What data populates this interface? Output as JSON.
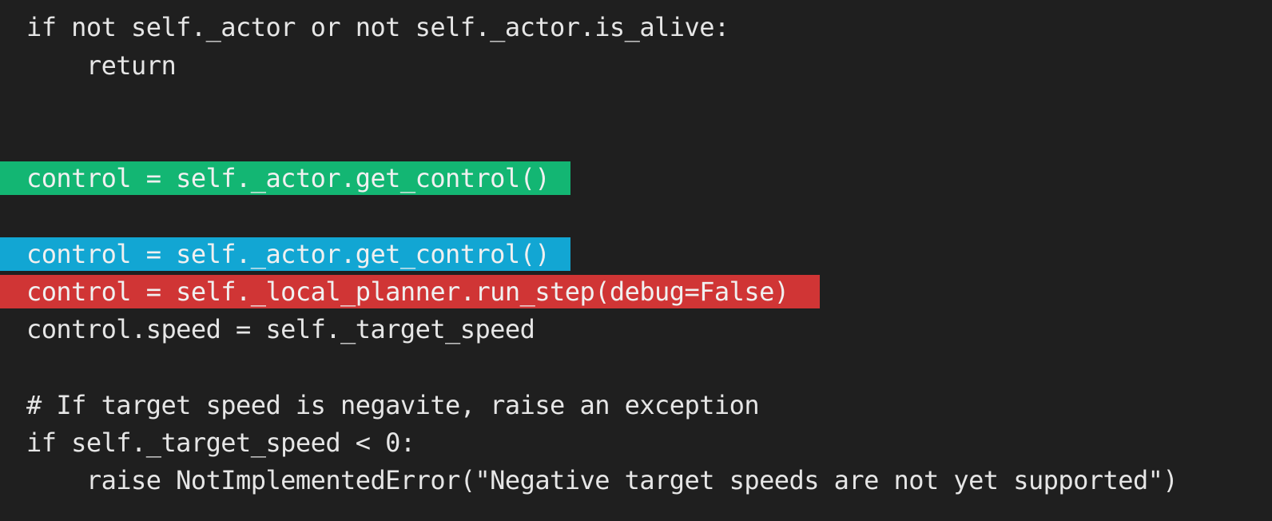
{
  "code_lines": [
    {
      "text": "if not self._actor or not self._actor.is_alive:",
      "highlight": ""
    },
    {
      "text": "    return",
      "highlight": ""
    },
    {
      "text": "",
      "highlight": ""
    },
    {
      "text": "",
      "highlight": ""
    },
    {
      "text": "control = self._actor.get_control()",
      "highlight": "#13b673"
    },
    {
      "text": "",
      "highlight": ""
    },
    {
      "text": "control = self._actor.get_control()",
      "highlight": "#12a6d3"
    },
    {
      "text": "control = self._local_planner.run_step(debug=False)",
      "highlight": "#d03535"
    },
    {
      "text": "control.speed = self._target_speed",
      "highlight": ""
    },
    {
      "text": "",
      "highlight": ""
    },
    {
      "text": "# If target speed is negavite, raise an exception",
      "highlight": ""
    },
    {
      "text": "if self._target_speed < 0:",
      "highlight": ""
    },
    {
      "text": "    raise NotImplementedError(\"Negative target speeds are not yet supported\")",
      "highlight": ""
    }
  ],
  "colors": {
    "background": "#1f1f1f",
    "text": "#e6e6e6",
    "added_green": "#13b673",
    "selected_blue": "#12a6d3",
    "removed_red": "#d03535"
  }
}
